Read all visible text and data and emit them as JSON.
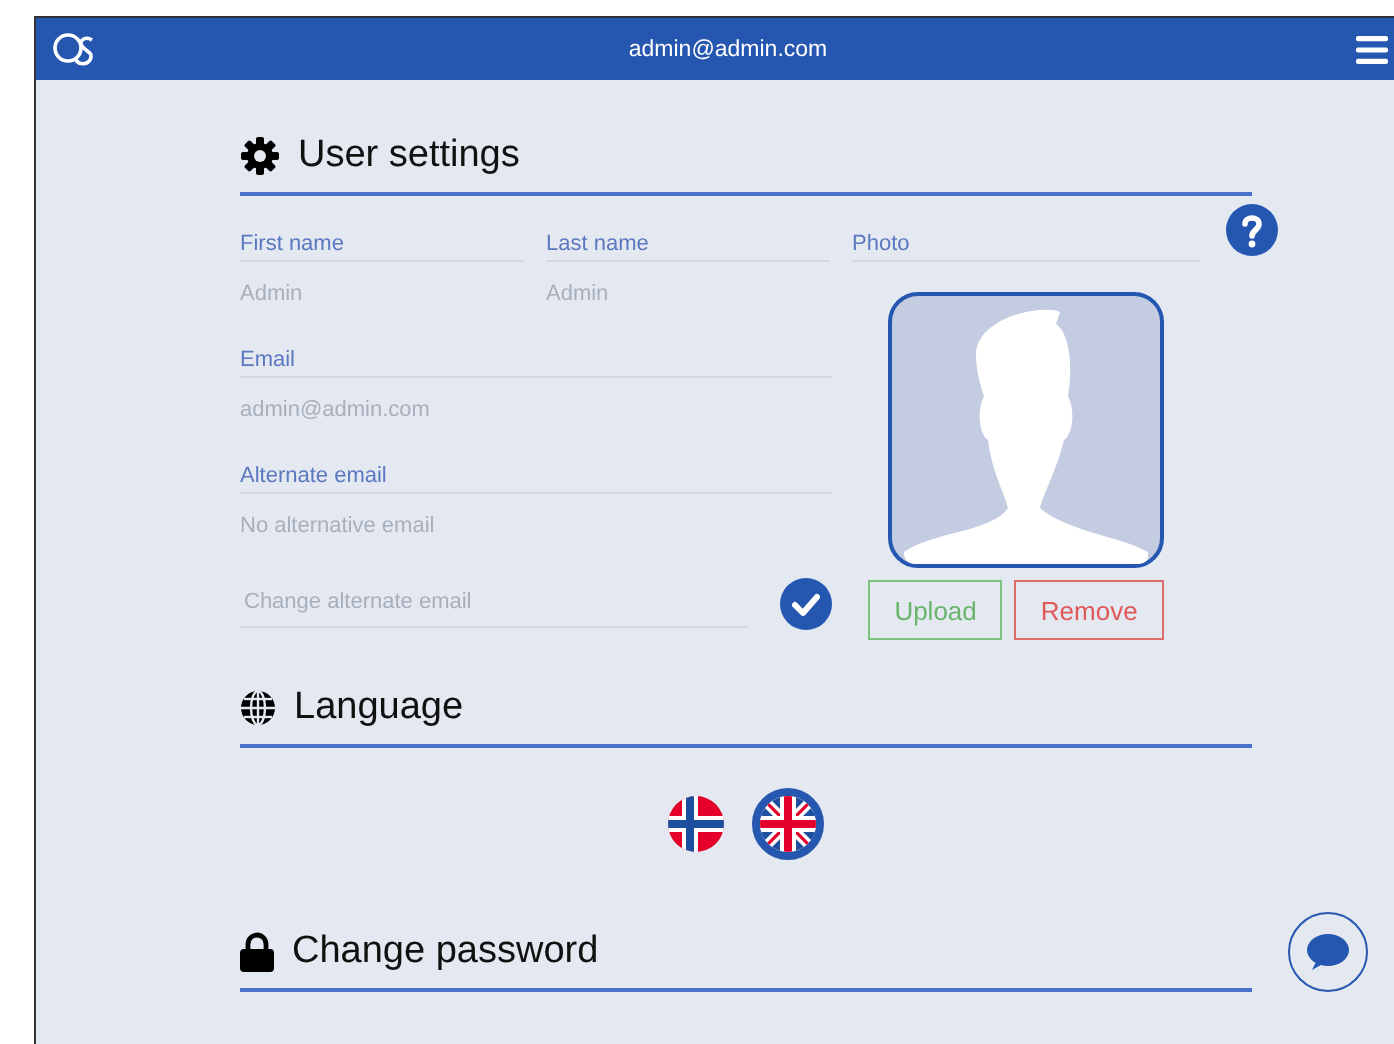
{
  "header": {
    "user": "admin@admin.com"
  },
  "user_settings": {
    "title": "User settings",
    "name_fields": [
      {
        "label": "First name",
        "value": "Admin"
      },
      {
        "label": "Last name",
        "value": "Admin"
      }
    ],
    "fields": [
      {
        "label": "Email",
        "value": "admin@admin.com"
      },
      {
        "label": "Alternate email",
        "value": "No alternative email"
      }
    ],
    "new_email": {
      "placeholder": "Change alternate email"
    },
    "photo": {
      "label": "Photo",
      "upload": "Upload",
      "remove": "Remove"
    }
  },
  "language": {
    "title": "Language",
    "options": [
      {
        "kind": "norway",
        "selected": false
      },
      {
        "kind": "uk",
        "selected": true
      }
    ]
  },
  "password": {
    "title": "Change password"
  }
}
